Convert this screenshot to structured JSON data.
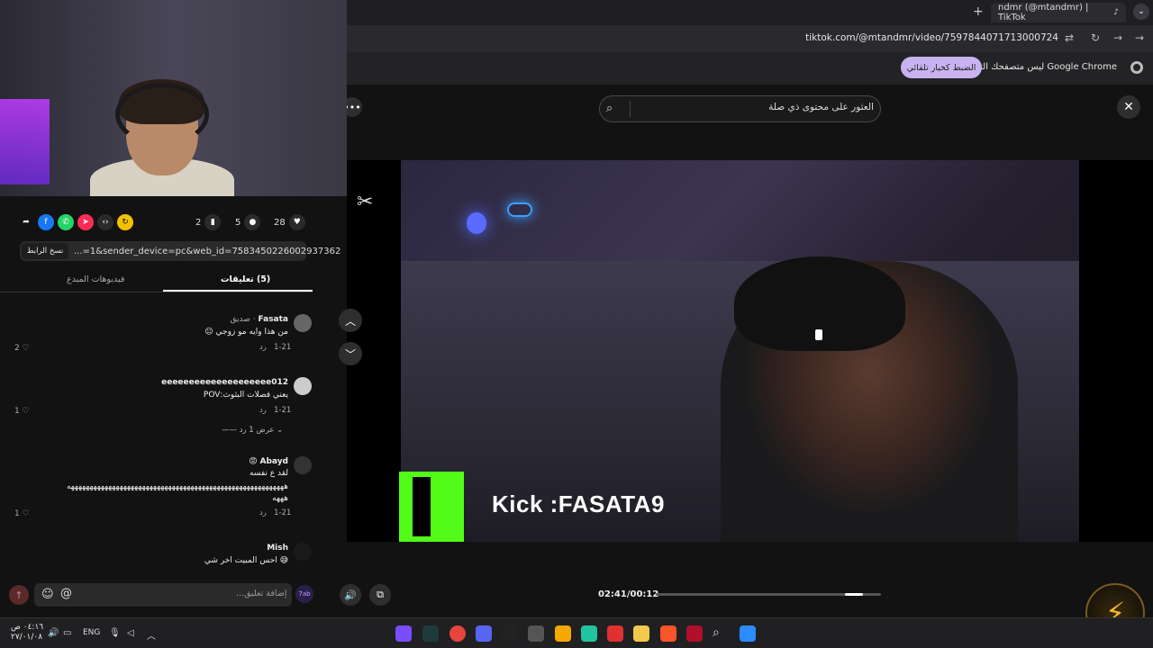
{
  "browser": {
    "tab_title": "ndmr (@mtandmr) | TikTok",
    "tab_close": "×",
    "new_tab": "+",
    "tab_menu": "⌄",
    "url": "tiktok.com/@mtandmr/video/7597844071713000724",
    "info_text": "Google Chrome ليس متصفحك التلقائي.",
    "info_button": "الضبط كخيار تلقائي"
  },
  "page": {
    "search_placeholder": "العثور على محتوى ذي صلة",
    "close": "✕",
    "more": "•••"
  },
  "video": {
    "overlay_text": "Kick :FASATA9",
    "capcut_mark": "✂",
    "time": "02:41/00:12",
    "progress_fraction": 0.92
  },
  "actions": {
    "likes": "28",
    "comments": "5",
    "saves": "2"
  },
  "share": {
    "link": "...=1&sender_device=pc&web_id=7583450226002937362",
    "copy_button": "نسخ الرابط"
  },
  "tabs": [
    {
      "label": "(5) تعليقات",
      "active": true
    },
    {
      "label": "فيديوهات المبدع",
      "active": false
    }
  ],
  "comments": [
    {
      "name": "Fasata",
      "badge": "· صديق",
      "text": "من هذا وايه مو زوجي 😐",
      "date": "1-21",
      "reply": "رد",
      "likes": "2"
    },
    {
      "name": "eeeeeeeeeeeeeeeeeeee012",
      "badge": "",
      "text": "يعني فصلات البثوث:POV",
      "date": "1-21",
      "reply": "رد",
      "likes": "1",
      "view_replies": "عرض 1 رد"
    },
    {
      "name": "Abayd",
      "badge": "😡",
      "text": "لقد ع نفسه",
      "text2": "ههههههههههههههههههههههههههههههههههههههههههههههههههههههههههه",
      "text3": "هههه",
      "date": "1-21",
      "reply": "رد",
      "likes": "1"
    },
    {
      "name": "Mish",
      "badge": "",
      "text": "😅 احس المبيت اخر شي",
      "date": "",
      "reply": "",
      "likes": ""
    }
  ],
  "composer": {
    "placeholder": "إضافة تعليق...",
    "emoji": "☺",
    "mention": "@",
    "avatar_label": "7ab"
  },
  "taskbar": {
    "time": "٠٤:١٦ ص",
    "date": "٢٧/٠١/٠٨",
    "lang": "ENG"
  },
  "colors": {
    "kick_green": "#53fc18",
    "accent_purple": "#c8b3f0",
    "bolt_gold": "#f2b628"
  }
}
